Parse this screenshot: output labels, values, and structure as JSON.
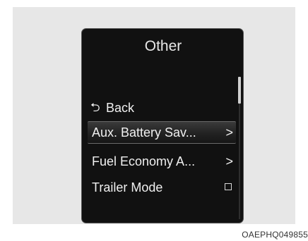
{
  "screen": {
    "title": "Other",
    "items": [
      {
        "icon": "back-arrow-icon",
        "label": "Back"
      },
      {
        "label": "Aux. Battery Sav...",
        "chevron": ">",
        "selected": true
      },
      {
        "label": "Fuel Economy A...",
        "chevron": ">"
      },
      {
        "label": "Trailer Mode",
        "checkbox_checked": false
      }
    ],
    "scroll_position_fraction": 0.0
  },
  "image_code": "OAEPHQ049855",
  "colors": {
    "screen_background": "#111111",
    "text": "#f0f0f0",
    "backdrop": "#e7e7e7"
  }
}
